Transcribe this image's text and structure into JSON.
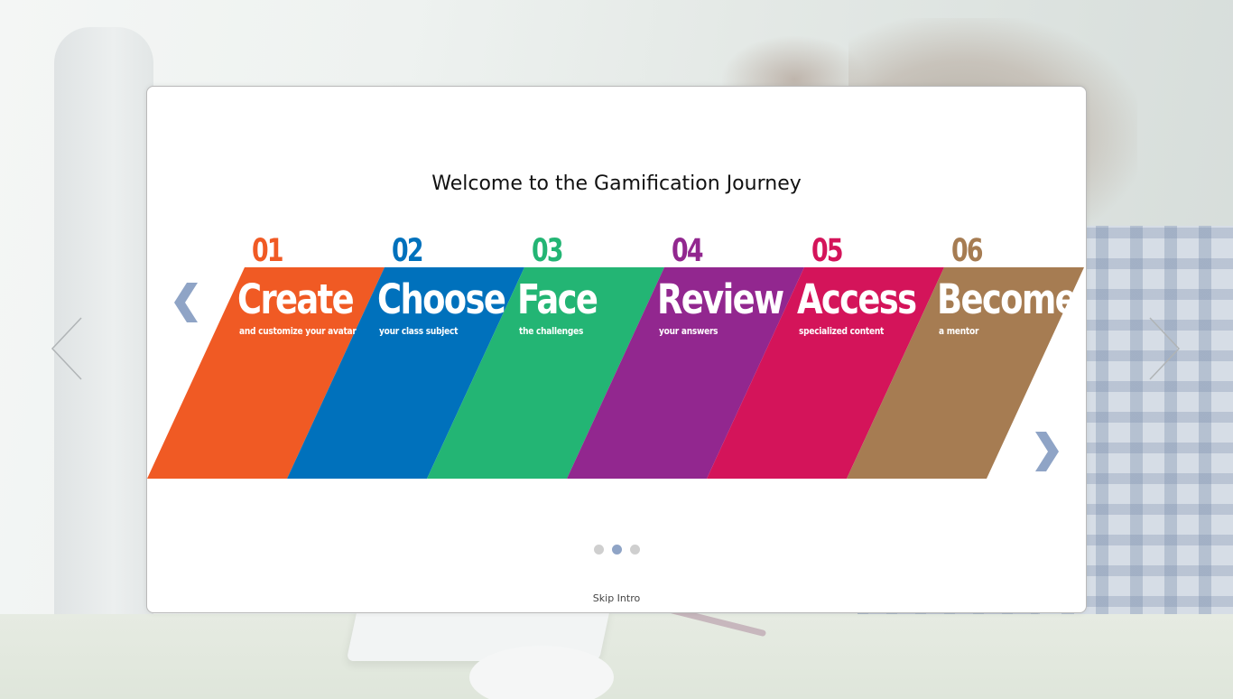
{
  "page": {
    "title": "Welcome to the Gamification Journey"
  },
  "steps": [
    {
      "number": "01",
      "label": "Create",
      "sub": "and customize your avatar",
      "color": "#f05a24"
    },
    {
      "number": "02",
      "label": "Choose",
      "sub": "your class subject",
      "color": "#0071bc"
    },
    {
      "number": "03",
      "label": "Face",
      "sub": "the challenges",
      "color": "#23b574"
    },
    {
      "number": "04",
      "label": "Review",
      "sub": "your answers",
      "color": "#92278f"
    },
    {
      "number": "05",
      "label": "Access",
      "sub": "specialized content",
      "color": "#d4145a"
    },
    {
      "number": "06",
      "label": "Become",
      "sub": "a mentor",
      "color": "#a67c52"
    }
  ],
  "carousel": {
    "slide_count": 3,
    "active_slide": 2
  },
  "controls": {
    "prev_icon": "chevron-left-icon",
    "next_icon": "chevron-right-icon",
    "arrow_color": "#8fa4c6"
  },
  "footer": {
    "skip_label": "Skip Intro"
  }
}
